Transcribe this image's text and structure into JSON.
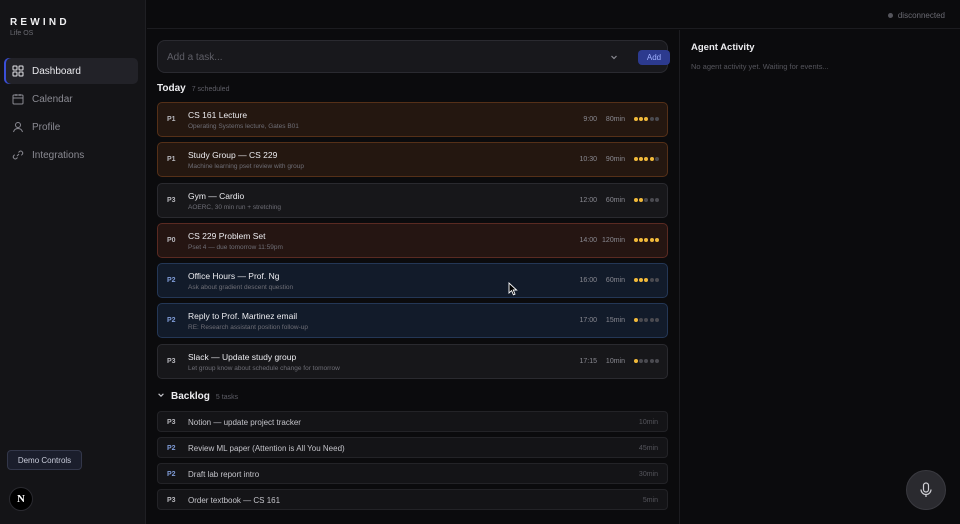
{
  "app": {
    "brand": "REWIND",
    "subtitle": "Life OS"
  },
  "sidebar": {
    "items": [
      {
        "label": "Dashboard",
        "icon": "grid-icon",
        "active": true
      },
      {
        "label": "Calendar",
        "icon": "calendar-icon",
        "active": false
      },
      {
        "label": "Profile",
        "icon": "user-icon",
        "active": false
      },
      {
        "label": "Integrations",
        "icon": "link-icon",
        "active": false
      }
    ],
    "demo_button": "Demo Controls",
    "avatar_letter": "N"
  },
  "topbar": {
    "status": "disconnected"
  },
  "add_task": {
    "placeholder": "Add a task...",
    "button": "Add"
  },
  "today": {
    "title": "Today",
    "count": "7 scheduled",
    "tasks": [
      {
        "priority": "P1",
        "title": "CS 161 Lecture",
        "subtitle": "Operating Systems lecture, Gates B01",
        "time": "9:00",
        "duration": "80min",
        "energy": 3
      },
      {
        "priority": "P1",
        "title": "Study Group — CS 229",
        "subtitle": "Machine learning pset review with group",
        "time": "10:30",
        "duration": "90min",
        "energy": 4
      },
      {
        "priority": "P3",
        "title": "Gym — Cardio",
        "subtitle": "AOERC, 30 min run + stretching",
        "time": "12:00",
        "duration": "60min",
        "energy": 2
      },
      {
        "priority": "P0",
        "title": "CS 229 Problem Set",
        "subtitle": "Pset 4 — due tomorrow 11:59pm",
        "time": "14:00",
        "duration": "120min",
        "energy": 5
      },
      {
        "priority": "P2",
        "title": "Office Hours — Prof. Ng",
        "subtitle": "Ask about gradient descent question",
        "time": "16:00",
        "duration": "60min",
        "energy": 3
      },
      {
        "priority": "P2",
        "title": "Reply to Prof. Martinez email",
        "subtitle": "RE: Research assistant position follow-up",
        "time": "17:00",
        "duration": "15min",
        "energy": 1
      },
      {
        "priority": "P3",
        "title": "Slack — Update study group",
        "subtitle": "Let group know about schedule change for tomorrow",
        "time": "17:15",
        "duration": "10min",
        "energy": 1
      }
    ]
  },
  "backlog": {
    "title": "Backlog",
    "count": "5 tasks",
    "items": [
      {
        "priority": "P3",
        "title": "Notion — update project tracker",
        "duration": "10min"
      },
      {
        "priority": "P2",
        "title": "Review ML paper (Attention is All You Need)",
        "duration": "45min"
      },
      {
        "priority": "P2",
        "title": "Draft lab report intro",
        "duration": "30min"
      },
      {
        "priority": "P3",
        "title": "Order textbook — CS 161",
        "duration": "5min"
      }
    ]
  },
  "agent": {
    "title": "Agent Activity",
    "empty": "No agent activity yet. Waiting for events..."
  },
  "colors": {
    "accent": "#3b4fd8",
    "energy": "#f1b93a",
    "p0": "#5a2a22",
    "p1": "#553018",
    "p2": "#243756"
  }
}
